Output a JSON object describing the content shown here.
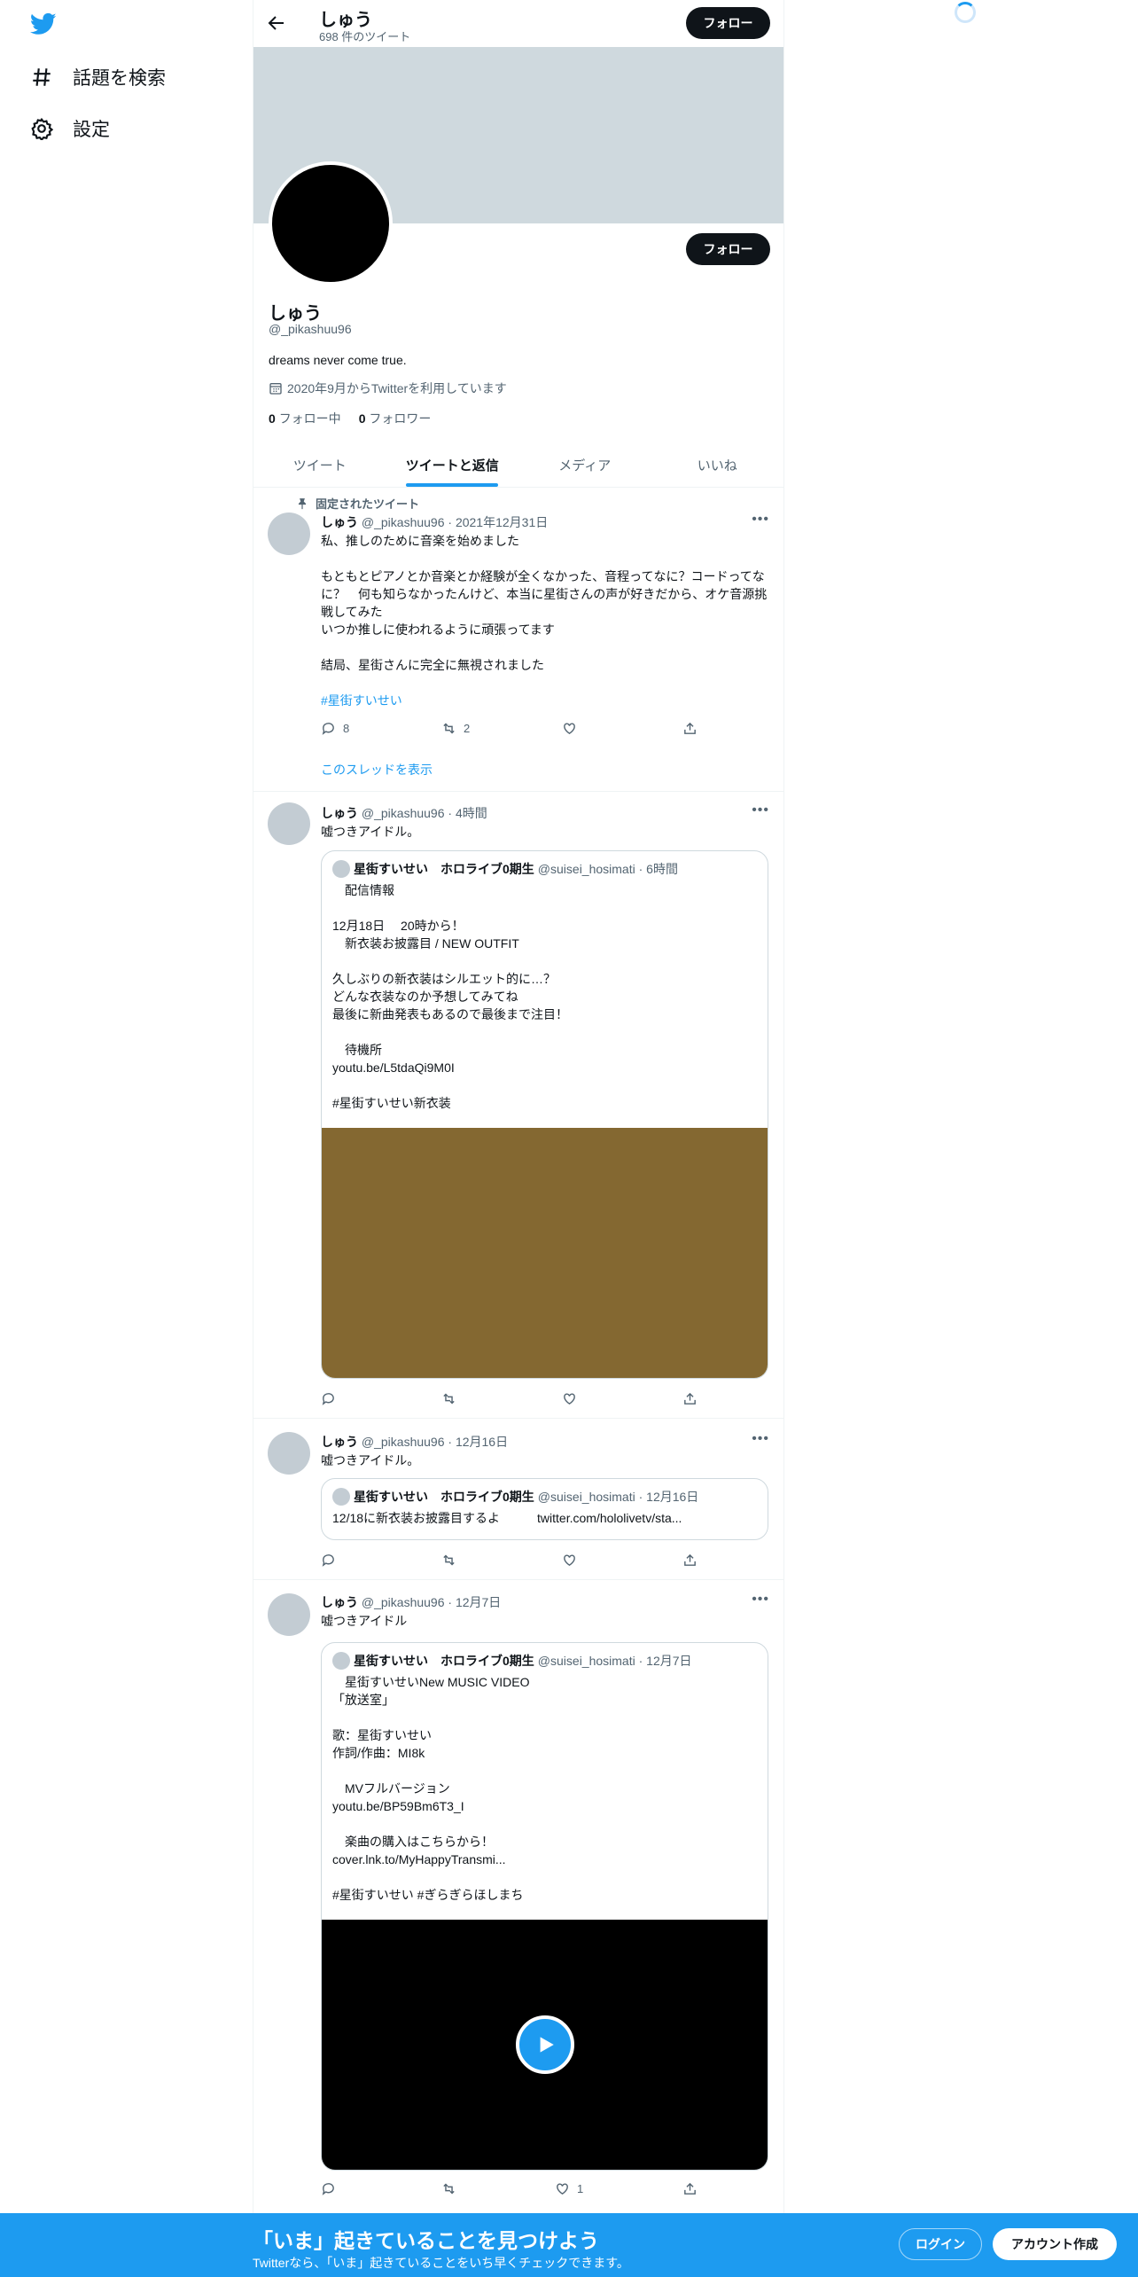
{
  "sidebar": {
    "items": [
      {
        "label": "話題を検索",
        "icon": "hashtag-icon"
      },
      {
        "label": "設定",
        "icon": "gear-icon"
      }
    ]
  },
  "header": {
    "name": "しゅう",
    "tweet_count": "698 件のツイート",
    "follow_label": "フォロー"
  },
  "profile": {
    "name": "しゅう",
    "handle": "@_pikashuu96",
    "bio": "dreams never come true.",
    "joined": "2020年9月からTwitterを利用しています",
    "following_count": "0",
    "following_label": "フォロー中",
    "followers_count": "0",
    "followers_label": "フォロワー",
    "follow_label": "フォロー"
  },
  "tabs": [
    "ツイート",
    "ツイートと返信",
    "メディア",
    "いいね"
  ],
  "pinned_label": "固定されたツイート",
  "tweets": [
    {
      "name": "しゅう",
      "meta": "@_pikashuu96 · 2021年12月31日",
      "text": "私、推しのために音楽を始めました\n\nもともとピアノとか音楽とか経験が全くなかった、音程ってなに？コードってなに？　何も知らなかったんけど、本当に星街さんの声が好きだから、オケ音源挑戦してみた\nいつか推しに使われるように頑張ってます\n\n結局、星街さんに完全に無視されました",
      "hashtag": "#星街すいせい",
      "replies": "8",
      "retweets": "2",
      "likes": "",
      "thread_link": "このスレッドを表示"
    },
    {
      "name": "しゅう",
      "meta": "@_pikashuu96 · 4時間",
      "text": "嘘つきアイドル。",
      "quote_name": "星街すいせい　ホロライブ0期生",
      "quote_meta": "@suisei_hosimati · 6時間",
      "quote_text": "　配信情報\n\n12月18日　 20時から！\n　新衣装お披露目 / NEW OUTFIT\n\n久しぶりの新衣装はシルエット的に…？\nどんな衣装なのか予想してみてね\n最後に新曲発表もあるので最後まで注目！\n\n　待機所\nyoutu.be/L5tdaQi9M0I\n\n#星街すいせい新衣装",
      "media_color": "#846831",
      "replies": "",
      "retweets": "",
      "likes": ""
    },
    {
      "name": "しゅう",
      "meta": "@_pikashuu96 · 12月16日",
      "text": "嘘つきアイドル。",
      "quote_name": "星街すいせい　ホロライブ0期生",
      "quote_meta": "@suisei_hosimati · 12月16日",
      "quote_text": "12/18に新衣装お披露目するよ　　　twitter.com/hololivetv/sta...",
      "replies": "",
      "retweets": "",
      "likes": ""
    },
    {
      "name": "しゅう",
      "meta": "@_pikashuu96 · 12月7日",
      "text": "嘘つきアイドル",
      "quote_name": "星街すいせい　ホロライブ0期生",
      "quote_meta": "@suisei_hosimati · 12月7日",
      "quote_text": "　星街すいせいNew MUSIC VIDEO\n「放送室」\n\n歌：星街すいせい\n作詞/作曲：MI8k\n\n　MVフルバージョン\nyoutu.be/BP59Bm6T3_I\n\n　楽曲の購入はこちらから！\ncover.lnk.to/MyHappyTransmi...\n\n#星街すいせい #ぎらぎらほしまち",
      "media_color": "#000000",
      "replies": "",
      "retweets": "",
      "likes": "1"
    }
  ],
  "bottom_bar": {
    "title": "「いま」起きていることを見つけよう",
    "subtitle": "Twitterなら、「いま」起きていることをいち早くチェックできます。",
    "login": "ログイン",
    "signup": "アカウント作成"
  },
  "colors": {
    "accent": "#1d9bf0",
    "banner": "#cfd9de",
    "media_brown": "#846831"
  }
}
